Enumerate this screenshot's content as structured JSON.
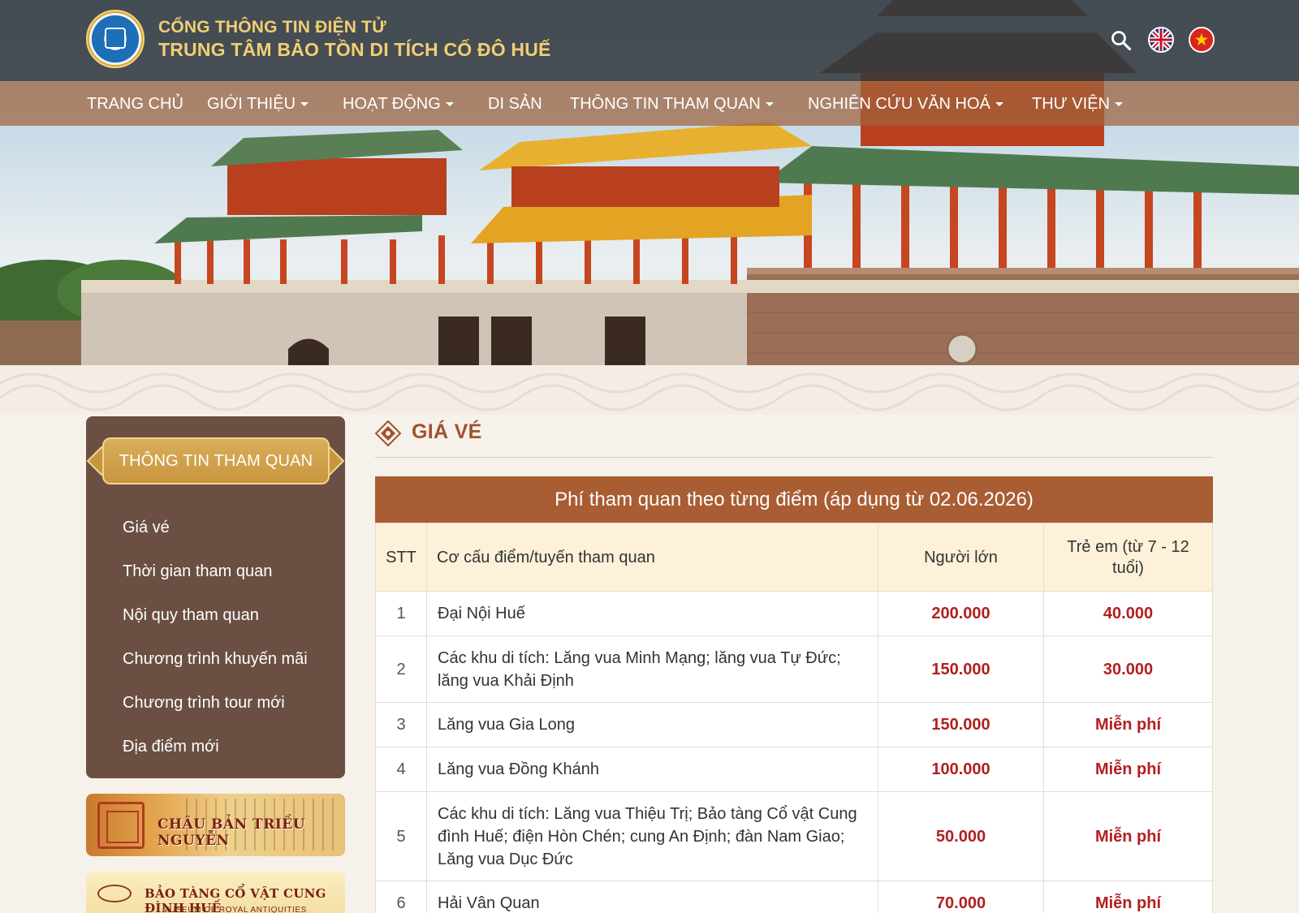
{
  "header": {
    "title_line1": "CỔNG THÔNG TIN ĐIỆN TỬ",
    "title_line2": "TRUNG TÂM BẢO TỒN DI TÍCH CỐ ĐÔ HUẾ",
    "icons": [
      "search-icon",
      "english-flag-icon",
      "vietnamese-flag-icon"
    ]
  },
  "nav": {
    "items": [
      {
        "label": "TRANG CHỦ",
        "dropdown": false
      },
      {
        "label": "GIỚI THIỆU",
        "dropdown": true
      },
      {
        "label": "HOẠT ĐỘNG",
        "dropdown": true
      },
      {
        "label": "DI SẢN",
        "dropdown": false
      },
      {
        "label": "THÔNG TIN THAM QUAN",
        "dropdown": true
      },
      {
        "label": "NGHIÊN CỨU VĂN HOÁ",
        "dropdown": true
      },
      {
        "label": "THƯ VIỆN",
        "dropdown": true
      }
    ]
  },
  "sidebar": {
    "title": "THÔNG TIN THAM QUAN",
    "items": [
      {
        "label": "Giá vé"
      },
      {
        "label": "Thời gian tham quan"
      },
      {
        "label": "Nội quy tham quan"
      },
      {
        "label": "Chương trình khuyến mãi"
      },
      {
        "label": "Chương trình tour mới"
      },
      {
        "label": "Địa điểm mới"
      }
    ],
    "promos": [
      {
        "label": "CHÂU BẢN TRIỀU NGUYỄN"
      },
      {
        "label": "BẢO TÀNG CỔ VẬT CUNG ĐÌNH HUẾ",
        "sub": "MUSEUM OF ROYAL ANTIQUITIES"
      }
    ]
  },
  "main": {
    "section_title": "GIÁ VÉ",
    "table": {
      "caption": "Phí tham quan theo từng điểm (áp dụng từ 02.06.2026)",
      "headers": {
        "stt": "STT",
        "name": "Cơ cấu điểm/tuyến tham quan",
        "adult": "Người lớn",
        "child": "Trẻ em (từ 7 - 12 tuổi)"
      },
      "rows": [
        {
          "stt": "1",
          "name": "Đại Nội Huế",
          "adult": "200.000",
          "child": "40.000"
        },
        {
          "stt": "2",
          "name": "Các khu di tích: Lăng vua Minh Mạng; lăng vua Tự Đức; lăng vua Khải Định",
          "adult": "150.000",
          "child": "30.000"
        },
        {
          "stt": "3",
          "name": "Lăng vua Gia Long",
          "adult": "150.000",
          "child": "Miễn phí"
        },
        {
          "stt": "4",
          "name": "Lăng vua Đồng Khánh",
          "adult": "100.000",
          "child": "Miễn phí"
        },
        {
          "stt": "5",
          "name": "Các khu di tích: Lăng vua Thiệu Trị; Bảo tàng Cổ vật Cung đình Huế; điện Hòn Chén; cung An Định; đàn Nam Giao; Lăng vua Dục Đức",
          "adult": "50.000",
          "child": "Miễn phí"
        },
        {
          "stt": "6",
          "name": "Hải Vân Quan",
          "adult": "70.000",
          "child": "Miễn phí"
        }
      ]
    }
  },
  "colors": {
    "topbar": "#34383c",
    "nav": "#a0623c",
    "gold_text": "#f0cf73",
    "sidebar_bg": "#6a4f42",
    "sidebar_title": "#c8963e",
    "section_title": "#a0522d",
    "table_caption": "#a95d33",
    "table_header": "#fdf1d9",
    "price": "#b21f1f"
  }
}
